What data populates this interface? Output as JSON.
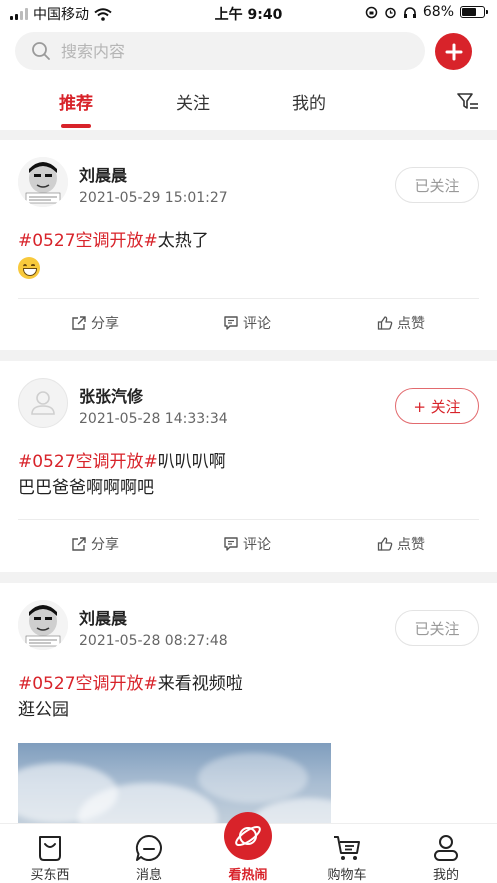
{
  "status_bar": {
    "carrier": "中国移动",
    "time": "上午 9:40",
    "battery": "68%",
    "battery_level": 0.68
  },
  "search": {
    "placeholder": "搜索内容"
  },
  "tabs": [
    {
      "label": "推荐",
      "active": true
    },
    {
      "label": "关注"
    },
    {
      "label": "我的"
    }
  ],
  "posts": [
    {
      "author": "刘晨晨",
      "time": "2021-05-29 15:01:27",
      "follow_label": "已关注",
      "tag": "#0527空调开放#",
      "text": "太热了",
      "share": "分享",
      "comment": "评论",
      "like": "点赞"
    },
    {
      "author": "张张汽修",
      "time": "2021-05-28 14:33:34",
      "follow_label": "+ 关注",
      "tag": "#0527空调开放#",
      "text": "叭叭叭啊",
      "text2": "巴巴爸爸啊啊啊吧",
      "share": "分享",
      "comment": "评论",
      "like": "点赞"
    },
    {
      "author": "刘晨晨",
      "time": "2021-05-28 08:27:48",
      "follow_label": "已关注",
      "tag": "#0527空调开放#",
      "text": "来看视频啦",
      "text2": "逛公园"
    }
  ],
  "bottom_nav": [
    {
      "label": "买东西",
      "icon": "shopping-bag-icon"
    },
    {
      "label": "消息",
      "icon": "message-icon"
    },
    {
      "label": "看热闹",
      "icon": "planet-icon"
    },
    {
      "label": "购物车",
      "icon": "cart-icon"
    },
    {
      "label": "我的",
      "icon": "user-icon"
    }
  ],
  "colors": {
    "accent": "#d8232a",
    "background": "#f2f2f2"
  }
}
